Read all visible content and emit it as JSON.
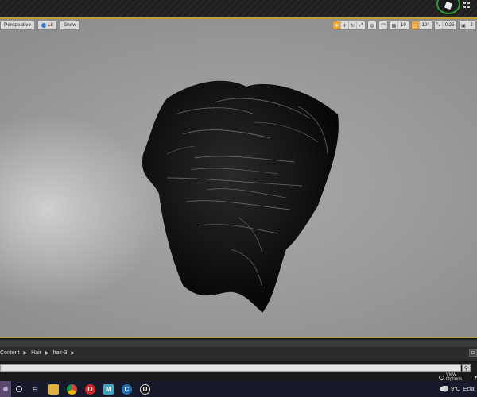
{
  "viewport": {
    "perspective_label": "Perspective",
    "lit_label": "Lit",
    "show_label": "Show",
    "grid_snap_value": "10",
    "rotation_snap_value": "10°",
    "scale_snap_value": "0.25",
    "camera_speed_value": "2"
  },
  "content_browser": {
    "breadcrumb": [
      "Content",
      "Hair",
      "hair-3"
    ],
    "search_placeholder": "",
    "view_options_label": "View Options"
  },
  "taskbar": {
    "temperature": "9°C",
    "weather_text": "Eclai"
  },
  "colors": {
    "viewport_border": "#c29a2a",
    "epic_badge_ring": "#2f9a34"
  }
}
